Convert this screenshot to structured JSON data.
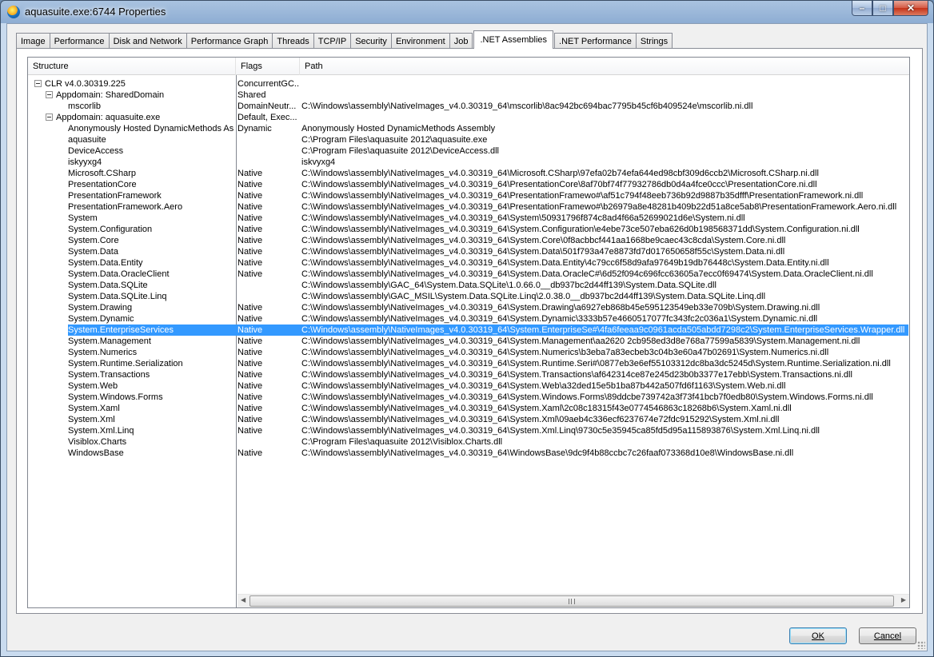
{
  "window": {
    "title": "aquasuite.exe:6744 Properties"
  },
  "tabs": [
    "Image",
    "Performance",
    "Disk and Network",
    "Performance Graph",
    "Threads",
    "TCP/IP",
    "Security",
    "Environment",
    "Job",
    ".NET Assemblies",
    ".NET Performance",
    "Strings"
  ],
  "active_tab": ".NET Assemblies",
  "columns": {
    "structure": "Structure",
    "flags": "Flags",
    "path": "Path"
  },
  "rows": [
    {
      "name": "CLR v4.0.30319.225",
      "flags": "ConcurrentGC...",
      "path": "",
      "indent": 0,
      "expander": true
    },
    {
      "name": "Appdomain: SharedDomain",
      "flags": "Shared",
      "path": "",
      "indent": 1,
      "expander": true
    },
    {
      "name": "mscorlib",
      "flags": "DomainNeutr...",
      "path": "C:\\Windows\\assembly\\NativeImages_v4.0.30319_64\\mscorlib\\8ac942bc694bac7795b45cf6b409524e\\mscorlib.ni.dll",
      "indent": 2,
      "expander": false
    },
    {
      "name": "Appdomain: aquasuite.exe",
      "flags": "Default, Exec...",
      "path": "",
      "indent": 1,
      "expander": true
    },
    {
      "name": "Anonymously Hosted DynamicMethods As...",
      "flags": "Dynamic",
      "path": "Anonymously Hosted DynamicMethods Assembly",
      "indent": 2,
      "expander": false
    },
    {
      "name": "aquasuite",
      "flags": "",
      "path": "C:\\Program Files\\aquasuite 2012\\aquasuite.exe",
      "indent": 2,
      "expander": false
    },
    {
      "name": "DeviceAccess",
      "flags": "",
      "path": "C:\\Program Files\\aquasuite 2012\\DeviceAccess.dll",
      "indent": 2,
      "expander": false
    },
    {
      "name": "iskyyxg4",
      "flags": "",
      "path": "iskvyxg4",
      "indent": 2,
      "expander": false
    },
    {
      "name": "Microsoft.CSharp",
      "flags": "Native",
      "path": "C:\\Windows\\assembly\\NativeImages_v4.0.30319_64\\Microsoft.CSharp\\97efa02b74efa644ed98cbf309d6ccb2\\Microsoft.CSharp.ni.dll",
      "indent": 2,
      "expander": false
    },
    {
      "name": "PresentationCore",
      "flags": "Native",
      "path": "C:\\Windows\\assembly\\NativeImages_v4.0.30319_64\\PresentationCore\\8af70bf74f77932786db0d4a4fce0ccc\\PresentationCore.ni.dll",
      "indent": 2,
      "expander": false
    },
    {
      "name": "PresentationFramework",
      "flags": "Native",
      "path": "C:\\Windows\\assembly\\NativeImages_v4.0.30319_64\\PresentationFramewo#\\af51c794f48eeb736b92d9887b35dfff\\PresentationFramework.ni.dll",
      "indent": 2,
      "expander": false
    },
    {
      "name": "PresentationFramework.Aero",
      "flags": "Native",
      "path": "C:\\Windows\\assembly\\NativeImages_v4.0.30319_64\\PresentationFramewo#\\b26979a8e48281b409b22d51a8ce5ab8\\PresentationFramework.Aero.ni.dll",
      "indent": 2,
      "expander": false
    },
    {
      "name": "System",
      "flags": "Native",
      "path": "C:\\Windows\\assembly\\NativeImages_v4.0.30319_64\\System\\50931796f874c8ad4f66a52699021d6e\\System.ni.dll",
      "indent": 2,
      "expander": false
    },
    {
      "name": "System.Configuration",
      "flags": "Native",
      "path": "C:\\Windows\\assembly\\NativeImages_v4.0.30319_64\\System.Configuration\\e4ebe73ce507eba626d0b198568371dd\\System.Configuration.ni.dll",
      "indent": 2,
      "expander": false
    },
    {
      "name": "System.Core",
      "flags": "Native",
      "path": "C:\\Windows\\assembly\\NativeImages_v4.0.30319_64\\System.Core\\0f8acbbcf441aa1668be9caec43c8cda\\System.Core.ni.dll",
      "indent": 2,
      "expander": false
    },
    {
      "name": "System.Data",
      "flags": "Native",
      "path": "C:\\Windows\\assembly\\NativeImages_v4.0.30319_64\\System.Data\\501f793a47e8873fd7d017650658f55c\\System.Data.ni.dll",
      "indent": 2,
      "expander": false
    },
    {
      "name": "System.Data.Entity",
      "flags": "Native",
      "path": "C:\\Windows\\assembly\\NativeImages_v4.0.30319_64\\System.Data.Entity\\4c79cc6f58d9afa97649b19db76448c\\System.Data.Entity.ni.dll",
      "indent": 2,
      "expander": false
    },
    {
      "name": "System.Data.OracleClient",
      "flags": "Native",
      "path": "C:\\Windows\\assembly\\NativeImages_v4.0.30319_64\\System.Data.OracleC#\\6d52f094c696fcc63605a7ecc0f69474\\System.Data.OracleClient.ni.dll",
      "indent": 2,
      "expander": false
    },
    {
      "name": "System.Data.SQLite",
      "flags": "",
      "path": "C:\\Windows\\assembly\\GAC_64\\System.Data.SQLite\\1.0.66.0__db937bc2d44ff139\\System.Data.SQLite.dll",
      "indent": 2,
      "expander": false
    },
    {
      "name": "System.Data.SQLite.Linq",
      "flags": "",
      "path": "C:\\Windows\\assembly\\GAC_MSIL\\System.Data.SQLite.Linq\\2.0.38.0__db937bc2d44ff139\\System.Data.SQLite.Linq.dll",
      "indent": 2,
      "expander": false
    },
    {
      "name": "System.Drawing",
      "flags": "Native",
      "path": "C:\\Windows\\assembly\\NativeImages_v4.0.30319_64\\System.Drawing\\a6927eb868b45e595123549eb33e709b\\System.Drawing.ni.dll",
      "indent": 2,
      "expander": false
    },
    {
      "name": "System.Dynamic",
      "flags": "Native",
      "path": "C:\\Windows\\assembly\\NativeImages_v4.0.30319_64\\System.Dynamic\\3333b57e4660517077fc343fc2c036a1\\System.Dynamic.ni.dll",
      "indent": 2,
      "expander": false
    },
    {
      "name": "System.EnterpriseServices",
      "flags": "Native",
      "path": "C:\\Windows\\assembly\\NativeImages_v4.0.30319_64\\System.EnterpriseSe#\\4fa6feeaa9c0961acda505abdd7298c2\\System.EnterpriseServices.Wrapper.dll",
      "indent": 2,
      "expander": false,
      "selected": true
    },
    {
      "name": "System.Management",
      "flags": "Native",
      "path": "C:\\Windows\\assembly\\NativeImages_v4.0.30319_64\\System.Management\\aa2620 2cb958ed3d8e768a77599a5839\\System.Management.ni.dll",
      "indent": 2,
      "expander": false
    },
    {
      "name": "System.Numerics",
      "flags": "Native",
      "path": "C:\\Windows\\assembly\\NativeImages_v4.0.30319_64\\System.Numerics\\b3eba7a83ecbeb3c04b3e60a47b02691\\System.Numerics.ni.dll",
      "indent": 2,
      "expander": false
    },
    {
      "name": "System.Runtime.Serialization",
      "flags": "Native",
      "path": "C:\\Windows\\assembly\\NativeImages_v4.0.30319_64\\System.Runtime.Seri#\\0877eb3e6ef55103312dc8ba3dc5245d\\System.Runtime.Serialization.ni.dll",
      "indent": 2,
      "expander": false
    },
    {
      "name": "System.Transactions",
      "flags": "Native",
      "path": "C:\\Windows\\assembly\\NativeImages_v4.0.30319_64\\System.Transactions\\af642314ce87e245d23b0b3377e17ebb\\System.Transactions.ni.dll",
      "indent": 2,
      "expander": false
    },
    {
      "name": "System.Web",
      "flags": "Native",
      "path": "C:\\Windows\\assembly\\NativeImages_v4.0.30319_64\\System.Web\\a32ded15e5b1ba87b442a507fd6f1163\\System.Web.ni.dll",
      "indent": 2,
      "expander": false
    },
    {
      "name": "System.Windows.Forms",
      "flags": "Native",
      "path": "C:\\Windows\\assembly\\NativeImages_v4.0.30319_64\\System.Windows.Forms\\89ddcbe739742a3f73f41bcb7f0edb80\\System.Windows.Forms.ni.dll",
      "indent": 2,
      "expander": false
    },
    {
      "name": "System.Xaml",
      "flags": "Native",
      "path": "C:\\Windows\\assembly\\NativeImages_v4.0.30319_64\\System.Xaml\\2c08c18315f43e0774546863c18268b6\\System.Xaml.ni.dll",
      "indent": 2,
      "expander": false
    },
    {
      "name": "System.Xml",
      "flags": "Native",
      "path": "C:\\Windows\\assembly\\NativeImages_v4.0.30319_64\\System.Xml\\09aeb4c336ecf6237674e72fdc915292\\System.Xml.ni.dll",
      "indent": 2,
      "expander": false
    },
    {
      "name": "System.Xml.Linq",
      "flags": "Native",
      "path": "C:\\Windows\\assembly\\NativeImages_v4.0.30319_64\\System.Xml.Linq\\9730c5e35945ca85fd5d95a115893876\\System.Xml.Linq.ni.dll",
      "indent": 2,
      "expander": false
    },
    {
      "name": "Visiblox.Charts",
      "flags": "",
      "path": "C:\\Program Files\\aquasuite 2012\\Visiblox.Charts.dll",
      "indent": 2,
      "expander": false
    },
    {
      "name": "WindowsBase",
      "flags": "Native",
      "path": "C:\\Windows\\assembly\\NativeImages_v4.0.30319_64\\WindowsBase\\9dc9f4b88ccbc7c26faaf073368d10e8\\WindowsBase.ni.dll",
      "indent": 2,
      "expander": false
    }
  ],
  "buttons": {
    "ok": "OK",
    "cancel": "Cancel"
  },
  "colors": {
    "selection": "#3399ff",
    "title_bar": "#8eadd3",
    "close_button": "#c43218"
  }
}
